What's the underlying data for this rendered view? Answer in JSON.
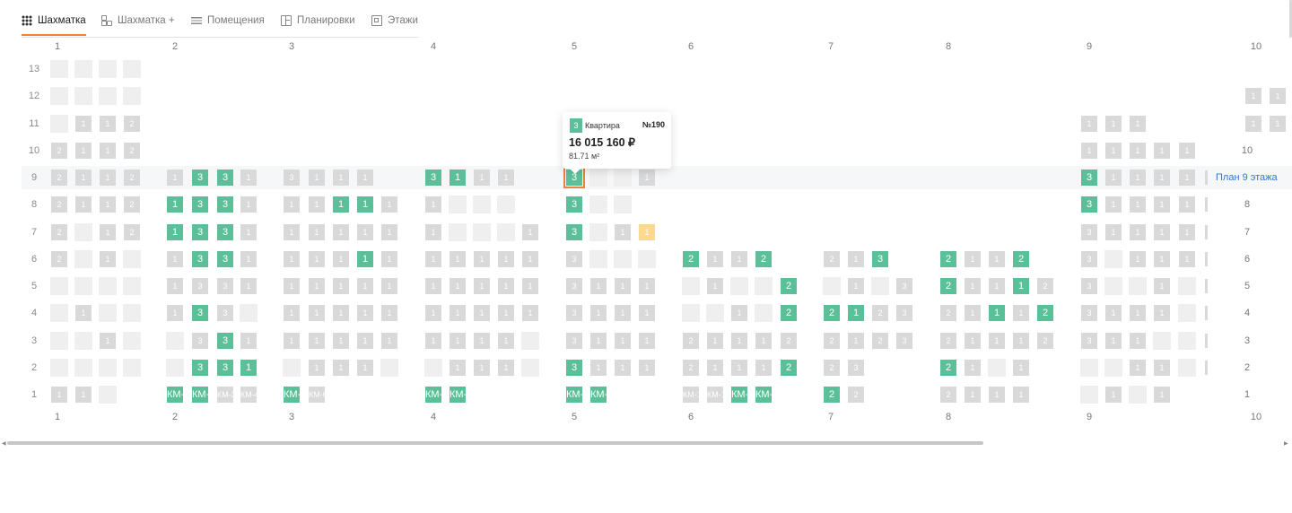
{
  "tabs": [
    {
      "label": "Шахматка",
      "icon": "grid-dots-icon",
      "active": true
    },
    {
      "label": "Шахматка +",
      "icon": "blocks-icon",
      "active": false
    },
    {
      "label": "Помещения",
      "icon": "list-icon",
      "active": false
    },
    {
      "label": "Планировки",
      "icon": "plan-icon",
      "active": false
    },
    {
      "label": "Этажи",
      "icon": "floor-icon",
      "active": false
    }
  ],
  "sections": [
    "1",
    "2",
    "3",
    "4",
    "5",
    "6",
    "7",
    "8",
    "9",
    "10"
  ],
  "floors": [
    "13",
    "12",
    "11",
    "10",
    "9",
    "8",
    "7",
    "6",
    "5",
    "4",
    "3",
    "2",
    "1"
  ],
  "right_labels": {
    "10": "10",
    "8": "8",
    "7": "7",
    "6": "6",
    "5": "5",
    "4": "4",
    "3": "3",
    "2": "2",
    "1": "1"
  },
  "plan_link": "План 9 этажа",
  "grid": [
    {
      "floor": "13",
      "cells": [
        [
          "e",
          ""
        ],
        [
          "e",
          ""
        ],
        [
          "e",
          ""
        ],
        [
          "e",
          ""
        ]
      ]
    },
    {
      "floor": "12",
      "cells": [
        [
          "e",
          ""
        ],
        [
          "e",
          ""
        ],
        [
          "e",
          ""
        ],
        [
          "e",
          ""
        ],
        [
          "g",
          "1"
        ],
        [
          "g",
          "1"
        ]
      ]
    },
    {
      "floor": "11",
      "cells": [
        [
          "e",
          ""
        ],
        [
          "g",
          "1"
        ],
        [
          "g",
          "1"
        ],
        [
          "g",
          "2"
        ],
        [
          "g",
          "1"
        ],
        [
          "g",
          "1"
        ],
        [
          "g",
          "1"
        ],
        [
          "g",
          "1"
        ],
        [
          "g",
          "1"
        ]
      ]
    },
    {
      "floor": "10",
      "cells": [
        [
          "g",
          "2"
        ],
        [
          "g",
          "1"
        ],
        [
          "g",
          "1"
        ],
        [
          "g",
          "2"
        ],
        [
          "g",
          "1"
        ],
        [
          "g",
          "1"
        ],
        [
          "g",
          "1"
        ],
        [
          "g",
          "1"
        ],
        [
          "g",
          "1"
        ]
      ]
    },
    {
      "floor": "9",
      "cells": [
        [
          "g",
          "2"
        ],
        [
          "g",
          "1"
        ],
        [
          "g",
          "1"
        ],
        [
          "g",
          "2"
        ],
        [
          "g",
          "1"
        ],
        [
          "G",
          "3"
        ],
        [
          "G",
          "3"
        ],
        [
          "g",
          "1"
        ],
        [
          "g",
          "3"
        ],
        [
          "g",
          "1"
        ],
        [
          "g",
          "1"
        ],
        [
          "g",
          "1"
        ],
        [
          "G",
          "3"
        ],
        [
          "G",
          "1"
        ],
        [
          "g",
          "1"
        ],
        [
          "g",
          "1"
        ],
        [
          "S",
          "3"
        ],
        [
          "e",
          ""
        ],
        [
          "e",
          ""
        ],
        [
          "g",
          "1"
        ],
        [
          "G",
          "3"
        ],
        [
          "g",
          "1"
        ],
        [
          "g",
          "1"
        ],
        [
          "g",
          "1"
        ],
        [
          "g",
          "1"
        ]
      ]
    },
    {
      "floor": "8",
      "cells": [
        [
          "g",
          "2"
        ],
        [
          "g",
          "1"
        ],
        [
          "g",
          "1"
        ],
        [
          "g",
          "2"
        ],
        [
          "G",
          "1"
        ],
        [
          "G",
          "3"
        ],
        [
          "G",
          "3"
        ],
        [
          "g",
          "1"
        ],
        [
          "g",
          "1"
        ],
        [
          "g",
          "1"
        ],
        [
          "G",
          "1"
        ],
        [
          "G",
          "1"
        ],
        [
          "g",
          "1"
        ],
        [
          "g",
          "1"
        ],
        [
          "e",
          ""
        ],
        [
          "e",
          ""
        ],
        [
          "e",
          ""
        ],
        [
          "G",
          "3"
        ],
        [
          "e",
          ""
        ],
        [
          "e",
          ""
        ],
        [
          "G",
          "3"
        ],
        [
          "g",
          "1"
        ],
        [
          "g",
          "1"
        ],
        [
          "g",
          "1"
        ],
        [
          "g",
          "1"
        ]
      ]
    },
    {
      "floor": "7",
      "cells": [
        [
          "g",
          "2"
        ],
        [
          "e",
          ""
        ],
        [
          "g",
          "1"
        ],
        [
          "g",
          "2"
        ],
        [
          "G",
          "1"
        ],
        [
          "G",
          "3"
        ],
        [
          "G",
          "3"
        ],
        [
          "g",
          "1"
        ],
        [
          "g",
          "1"
        ],
        [
          "g",
          "1"
        ],
        [
          "g",
          "1"
        ],
        [
          "g",
          "1"
        ],
        [
          "g",
          "1"
        ],
        [
          "g",
          "1"
        ],
        [
          "e",
          ""
        ],
        [
          "e",
          ""
        ],
        [
          "e",
          ""
        ],
        [
          "g",
          "1"
        ],
        [
          "G",
          "3"
        ],
        [
          "e",
          ""
        ],
        [
          "g",
          "1"
        ],
        [
          "Y",
          "1"
        ],
        [
          "g",
          "3"
        ],
        [
          "g",
          "1"
        ],
        [
          "g",
          "1"
        ],
        [
          "g",
          "1"
        ],
        [
          "g",
          "1"
        ]
      ]
    },
    {
      "floor": "6",
      "cells": [
        [
          "g",
          "2"
        ],
        [
          "e",
          ""
        ],
        [
          "g",
          "1"
        ],
        [
          "e",
          ""
        ],
        [
          "g",
          "1"
        ],
        [
          "G",
          "3"
        ],
        [
          "G",
          "3"
        ],
        [
          "g",
          "1"
        ],
        [
          "g",
          "1"
        ],
        [
          "g",
          "1"
        ],
        [
          "g",
          "1"
        ],
        [
          "G",
          "1"
        ],
        [
          "g",
          "1"
        ],
        [
          "g",
          "1"
        ],
        [
          "g",
          "1"
        ],
        [
          "g",
          "1"
        ],
        [
          "g",
          "1"
        ],
        [
          "g",
          "1"
        ],
        [
          "g",
          "3"
        ],
        [
          "e",
          ""
        ],
        [
          "e",
          ""
        ],
        [
          "e",
          ""
        ],
        [
          "G",
          "2"
        ],
        [
          "g",
          "1"
        ],
        [
          "g",
          "1"
        ],
        [
          "G",
          "2"
        ],
        [
          "g",
          "2"
        ],
        [
          "g",
          "1"
        ],
        [
          "G",
          "3"
        ],
        [
          "G",
          "2"
        ],
        [
          "g",
          "1"
        ],
        [
          "g",
          "1"
        ],
        [
          "G",
          "2"
        ],
        [
          "g",
          "3"
        ],
        [
          "e",
          ""
        ],
        [
          "g",
          "1"
        ],
        [
          "g",
          "1"
        ],
        [
          "g",
          "1"
        ]
      ]
    },
    {
      "floor": "5",
      "cells": [
        [
          "e",
          ""
        ],
        [
          "e",
          ""
        ],
        [
          "e",
          ""
        ],
        [
          "e",
          ""
        ],
        [
          "g",
          "1"
        ],
        [
          "g",
          "3"
        ],
        [
          "g",
          "3"
        ],
        [
          "g",
          "1"
        ],
        [
          "g",
          "1"
        ],
        [
          "g",
          "1"
        ],
        [
          "g",
          "1"
        ],
        [
          "g",
          "1"
        ],
        [
          "g",
          "1"
        ],
        [
          "g",
          "1"
        ],
        [
          "g",
          "1"
        ],
        [
          "g",
          "1"
        ],
        [
          "g",
          "1"
        ],
        [
          "g",
          "1"
        ],
        [
          "g",
          "3"
        ],
        [
          "g",
          "1"
        ],
        [
          "g",
          "1"
        ],
        [
          "g",
          "1"
        ],
        [
          "e",
          ""
        ],
        [
          "g",
          "1"
        ],
        [
          "e",
          ""
        ],
        [
          "e",
          ""
        ],
        [
          "G",
          "2"
        ],
        [
          "e",
          ""
        ],
        [
          "g",
          "1"
        ],
        [
          "e",
          ""
        ],
        [
          "g",
          "3"
        ],
        [
          "G",
          "2"
        ],
        [
          "g",
          "1"
        ],
        [
          "g",
          "1"
        ],
        [
          "G",
          "1"
        ],
        [
          "g",
          "2"
        ],
        [
          "g",
          "3"
        ],
        [
          "e",
          ""
        ],
        [
          "e",
          ""
        ],
        [
          "g",
          "1"
        ],
        [
          "e",
          ""
        ]
      ]
    },
    {
      "floor": "4",
      "cells": [
        [
          "e",
          ""
        ],
        [
          "g",
          "1"
        ],
        [
          "e",
          ""
        ],
        [
          "e",
          ""
        ],
        [
          "g",
          "1"
        ],
        [
          "G",
          "3"
        ],
        [
          "g",
          "3"
        ],
        [
          "e",
          ""
        ],
        [
          "g",
          "1"
        ],
        [
          "g",
          "1"
        ],
        [
          "g",
          "1"
        ],
        [
          "g",
          "1"
        ],
        [
          "g",
          "1"
        ],
        [
          "g",
          "1"
        ],
        [
          "g",
          "1"
        ],
        [
          "g",
          "1"
        ],
        [
          "g",
          "1"
        ],
        [
          "g",
          "1"
        ],
        [
          "g",
          "3"
        ],
        [
          "g",
          "1"
        ],
        [
          "g",
          "1"
        ],
        [
          "g",
          "1"
        ],
        [
          "e",
          ""
        ],
        [
          "e",
          ""
        ],
        [
          "g",
          "1"
        ],
        [
          "e",
          ""
        ],
        [
          "G",
          "2"
        ],
        [
          "G",
          "2"
        ],
        [
          "G",
          "1"
        ],
        [
          "g",
          "2"
        ],
        [
          "g",
          "3"
        ],
        [
          "g",
          "2"
        ],
        [
          "g",
          "1"
        ],
        [
          "G",
          "1"
        ],
        [
          "g",
          "1"
        ],
        [
          "G",
          "2"
        ],
        [
          "g",
          "3"
        ],
        [
          "g",
          "1"
        ],
        [
          "g",
          "1"
        ],
        [
          "g",
          "1"
        ],
        [
          "e",
          ""
        ]
      ]
    },
    {
      "floor": "3",
      "cells": [
        [
          "e",
          ""
        ],
        [
          "e",
          ""
        ],
        [
          "g",
          "1"
        ],
        [
          "e",
          ""
        ],
        [
          "e",
          ""
        ],
        [
          "g",
          "3"
        ],
        [
          "G",
          "3"
        ],
        [
          "g",
          "1"
        ],
        [
          "g",
          "1"
        ],
        [
          "g",
          "1"
        ],
        [
          "g",
          "1"
        ],
        [
          "g",
          "1"
        ],
        [
          "g",
          "1"
        ],
        [
          "g",
          "1"
        ],
        [
          "g",
          "1"
        ],
        [
          "g",
          "1"
        ],
        [
          "g",
          "1"
        ],
        [
          "e",
          ""
        ],
        [
          "g",
          "3"
        ],
        [
          "g",
          "1"
        ],
        [
          "g",
          "1"
        ],
        [
          "g",
          "1"
        ],
        [
          "g",
          "2"
        ],
        [
          "g",
          "1"
        ],
        [
          "g",
          "1"
        ],
        [
          "g",
          "1"
        ],
        [
          "g",
          "2"
        ],
        [
          "g",
          "2"
        ],
        [
          "g",
          "1"
        ],
        [
          "g",
          "2"
        ],
        [
          "g",
          "3"
        ],
        [
          "g",
          "2"
        ],
        [
          "g",
          "1"
        ],
        [
          "g",
          "1"
        ],
        [
          "g",
          "1"
        ],
        [
          "g",
          "2"
        ],
        [
          "g",
          "3"
        ],
        [
          "g",
          "1"
        ],
        [
          "g",
          "1"
        ],
        [
          "e",
          ""
        ],
        [
          "e",
          ""
        ]
      ]
    },
    {
      "floor": "2",
      "cells": [
        [
          "e",
          ""
        ],
        [
          "e",
          ""
        ],
        [
          "e",
          ""
        ],
        [
          "e",
          ""
        ],
        [
          "e",
          ""
        ],
        [
          "G",
          "3"
        ],
        [
          "G",
          "3"
        ],
        [
          "G",
          "1"
        ],
        [
          "e",
          ""
        ],
        [
          "g",
          "1"
        ],
        [
          "g",
          "1"
        ],
        [
          "g",
          "1"
        ],
        [
          "e",
          ""
        ],
        [
          "e",
          ""
        ],
        [
          "g",
          "1"
        ],
        [
          "g",
          "1"
        ],
        [
          "g",
          "1"
        ],
        [
          "e",
          ""
        ],
        [
          "G",
          "3"
        ],
        [
          "g",
          "1"
        ],
        [
          "g",
          "1"
        ],
        [
          "g",
          "1"
        ],
        [
          "g",
          "2"
        ],
        [
          "g",
          "1"
        ],
        [
          "g",
          "1"
        ],
        [
          "g",
          "1"
        ],
        [
          "G",
          "2"
        ],
        [
          "g",
          "2"
        ],
        [
          "g",
          "3"
        ],
        [
          "G",
          "2"
        ],
        [
          "g",
          "1"
        ],
        [
          "e",
          ""
        ],
        [
          "g",
          "1"
        ],
        [
          "e",
          ""
        ],
        [
          "e",
          ""
        ],
        [
          "g",
          "1"
        ],
        [
          "g",
          "1"
        ],
        [
          "e",
          ""
        ],
        [
          "g",
          "1"
        ],
        [
          "g",
          "1"
        ]
      ]
    },
    {
      "floor": "1",
      "cells": [
        [
          "g",
          "1"
        ],
        [
          "g",
          "1"
        ],
        [
          "e",
          ""
        ],
        [
          "G",
          "КМ-1"
        ],
        [
          "G",
          "КМ-2"
        ],
        [
          "g",
          "КМ-3"
        ],
        [
          "g",
          "КМ-4"
        ],
        [
          "G",
          "КМ-5"
        ],
        [
          "g",
          "КМ-6"
        ],
        [
          "G",
          "КМ-7"
        ],
        [
          "G",
          "КМ-8"
        ],
        [
          "G",
          "КМ-9"
        ],
        [
          "G",
          "КМ-10"
        ],
        [
          "g",
          "КМ-11"
        ],
        [
          "g",
          "КМ-12"
        ],
        [
          "G",
          "КМ-13"
        ],
        [
          "G",
          "КМ-14"
        ],
        [
          "G",
          "2"
        ],
        [
          "g",
          "2"
        ],
        [
          "g",
          "2"
        ],
        [
          "g",
          "1"
        ],
        [
          "g",
          "1"
        ],
        [
          "g",
          "1"
        ],
        [
          "e",
          ""
        ],
        [
          "g",
          "1"
        ],
        [
          "e",
          ""
        ],
        [
          "g",
          "1"
        ]
      ]
    }
  ],
  "tooltip": {
    "rooms": "3",
    "type": "Квартира",
    "number": "№190",
    "price": "16 015 160 ₽",
    "area": "81.71 м²"
  },
  "colors": {
    "accent": "#e8843d",
    "available": "#5bc09a",
    "unavailable": "#d9d9d9",
    "reserved": "#fbd98d",
    "empty": "#efefef",
    "link": "#2f76d8"
  }
}
